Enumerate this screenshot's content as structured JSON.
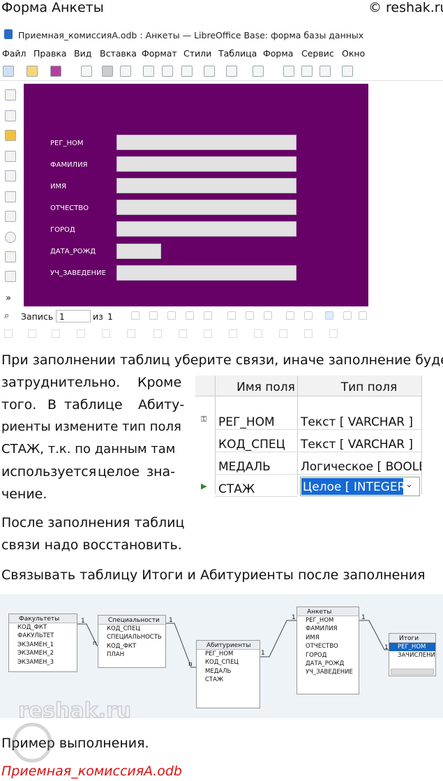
{
  "header": {
    "title": "Форма Анкеты",
    "copyright": "© reshak.ru"
  },
  "window": {
    "title": "Приемная_комиссияА.odb : Анкеты — LibreOffice Base: форма базы данных",
    "menu": [
      "Файл",
      "Правка",
      "Вид",
      "Вставка",
      "Формат",
      "Стили",
      "Таблица",
      "Форма",
      "Сервис",
      "Окно"
    ]
  },
  "form": {
    "labels": [
      "РЕГ_НОМ",
      "ФАМИЛИЯ",
      "ИМЯ",
      "ОТЧЕСТВО",
      "ГОРОД",
      "ДАТА_РОЖД",
      "УЧ_ЗАВЕДЕНИЕ"
    ],
    "bg": "#670067"
  },
  "record_nav": {
    "record_label": "Запись",
    "record_value": "1",
    "of_label": "из",
    "total": "1"
  },
  "text": {
    "intro": "При заполнении таблиц уберите связи, иначе заполнение будет",
    "col": [
      "затруднительно.",
      "Кроме",
      "того.",
      "В",
      "таблице",
      "Абиту-",
      "риенты измените тип поля",
      "СТАЖ, т.к. по данным там",
      "используется",
      "целое",
      "зна-",
      "чение."
    ],
    "restore1": "После заполнения таблиц",
    "restore2": "связи надо восстановить.",
    "link": "Связывать таблицу Итоги и Абитуриенты после заполнения",
    "example": "Пример выполнения.",
    "file": "Приемная_комиссияА.odb"
  },
  "field_table": {
    "headers": [
      "Имя поля",
      "Тип поля"
    ],
    "rows": [
      {
        "name": "РЕГ_НОМ",
        "type": "Текст [ VARCHAR ]"
      },
      {
        "name": "КОД_СПЕЦ",
        "type": "Текст [ VARCHAR ]"
      },
      {
        "name": "МЕДАЛЬ",
        "type": "Логическое [ BOOLEAN ]"
      },
      {
        "name": "СТАЖ",
        "type": "Целое [ INTEGER ]"
      }
    ]
  },
  "diagram": {
    "tables": [
      {
        "title": "Факультеты",
        "fields": [
          "КОД_ФКТ",
          "ФАКУЛЬТЕТ",
          "ЭКЗАМЕН_1",
          "ЭКЗАМЕН_2",
          "ЭКЗАМЕН_3"
        ]
      },
      {
        "title": "Специальности",
        "fields": [
          "КОД_СПЕЦ",
          "СПЕЦИАЛЬНОСТЬ",
          "КОД_ФКТ",
          "ПЛАН"
        ]
      },
      {
        "title": "Абитуриенты",
        "fields": [
          "РЕГ_НОМ",
          "КОД_СПЕЦ",
          "МЕДАЛЬ",
          "СТАЖ"
        ]
      },
      {
        "title": "Анкеты",
        "fields": [
          "РЕГ_НОМ",
          "ФАМИЛИЯ",
          "ИМЯ",
          "ОТЧЕСТВО",
          "ГОРОД",
          "ДАТА_РОЖД",
          "УЧ_ЗАВЕДЕНИЕ"
        ]
      },
      {
        "title": "Итоги",
        "fields": [
          "РЕГ_НОМ",
          "ЗАЧИСЛЕНИ"
        ]
      }
    ],
    "card_one": "1",
    "card_n": "n"
  },
  "watermark": "reshak.ru"
}
